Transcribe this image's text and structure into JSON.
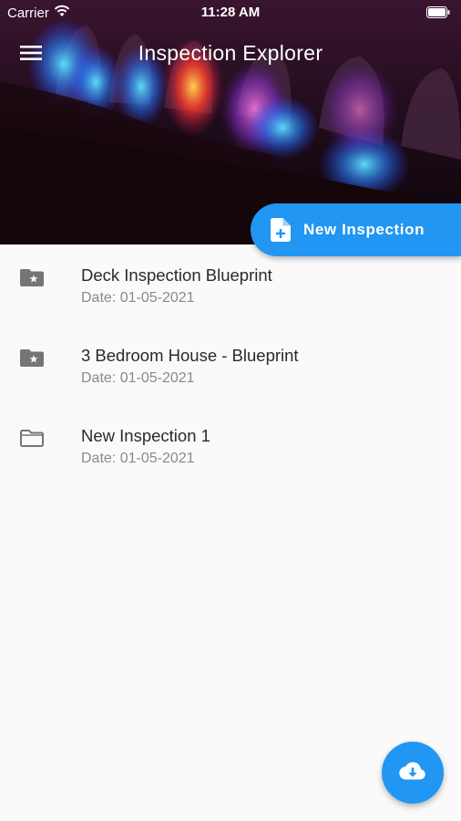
{
  "status_bar": {
    "carrier": "Carrier",
    "time": "11:28 AM"
  },
  "app_bar": {
    "title": "Inspection Explorer",
    "menu_icon": "hamburger-menu-icon"
  },
  "new_inspection_button": {
    "label": "New Inspection",
    "icon": "file-add-icon"
  },
  "inspections": [
    {
      "title": "Deck Inspection Blueprint",
      "date": "Date: 01-05-2021",
      "icon": "folder-star-icon"
    },
    {
      "title": "3 Bedroom House - Blueprint",
      "date": "Date: 01-05-2021",
      "icon": "folder-star-icon"
    },
    {
      "title": "New Inspection 1",
      "date": "Date: 01-05-2021",
      "icon": "folder-outline-icon"
    }
  ],
  "download_fab": {
    "icon": "cloud-download-icon"
  },
  "colors": {
    "accent": "#2196f3",
    "background": "#fafafa",
    "title_text": "#2a2a2a",
    "subtitle_text": "#8a8a8a",
    "icon_grey": "#757575"
  }
}
